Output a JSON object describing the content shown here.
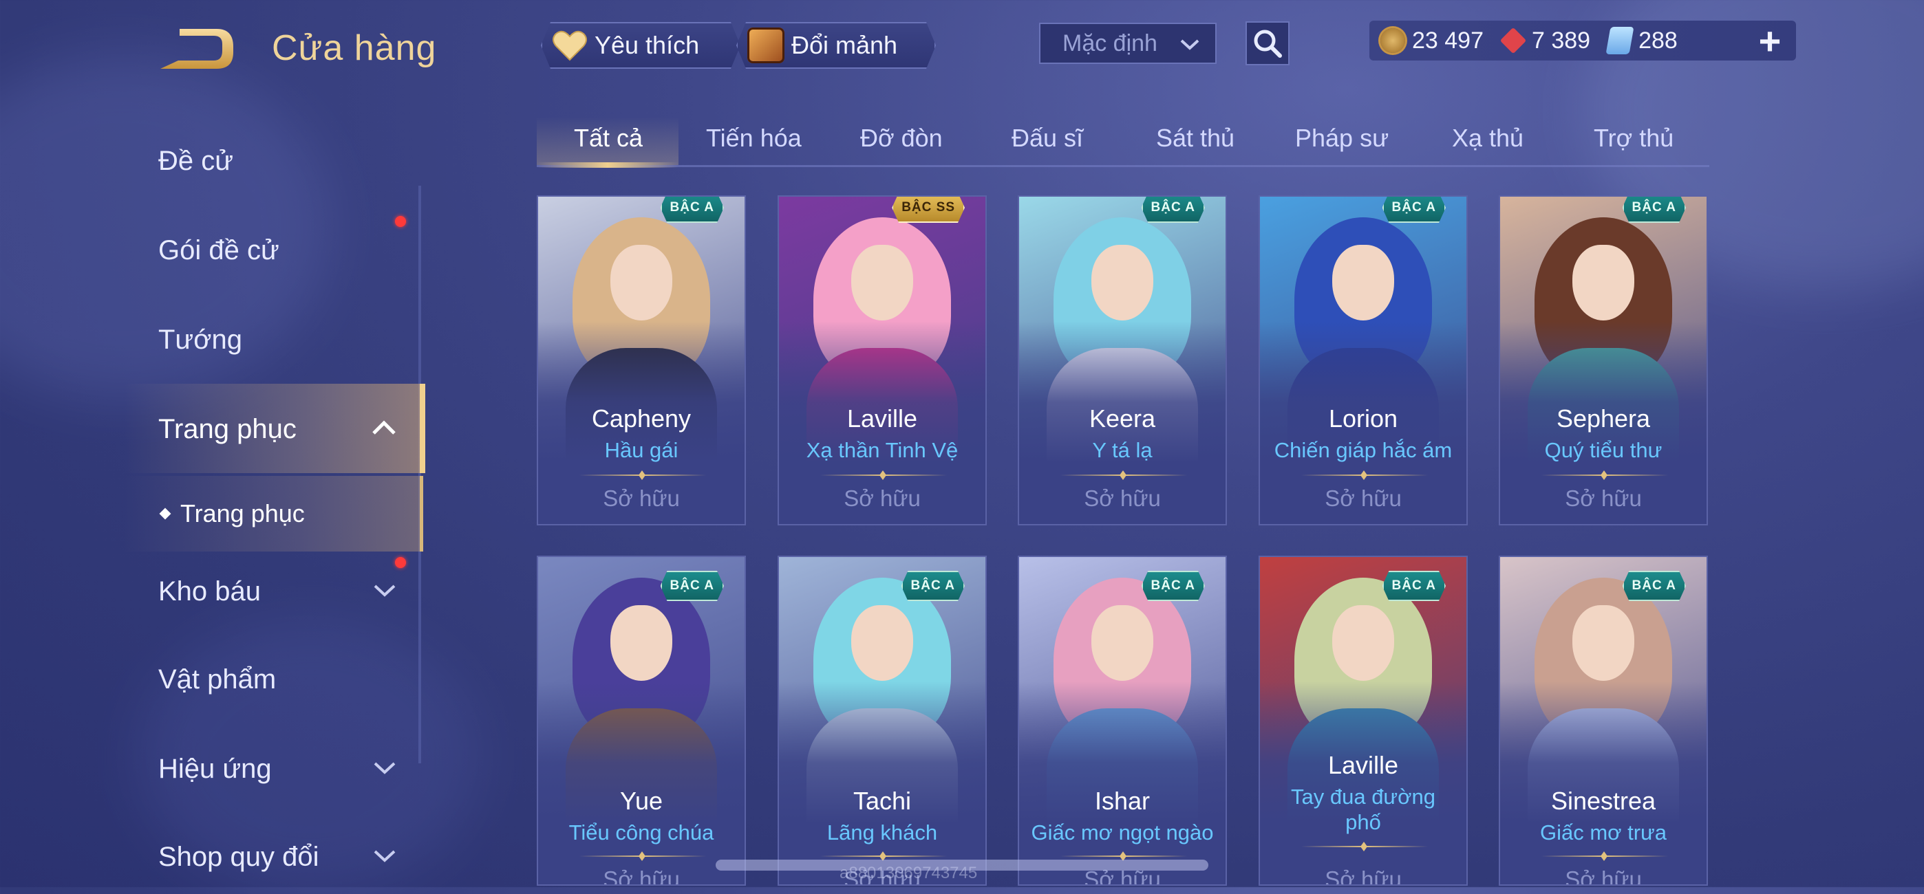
{
  "header": {
    "title": "Cửa hàng",
    "favorite_label": "Yêu thích",
    "exchange_label": "Đổi mảnh",
    "sort_value": "Mặc định",
    "currencies": [
      {
        "icon": "gold-coin-icon",
        "value": "23 497"
      },
      {
        "icon": "ruby-gem-icon",
        "value": "7 389"
      },
      {
        "icon": "voucher-icon",
        "value": "288"
      }
    ],
    "add_label": "+"
  },
  "sidebar": {
    "items": [
      {
        "label": "Đề cử"
      },
      {
        "label": "Gói đề cử"
      },
      {
        "label": "Tướng"
      },
      {
        "label": "Trang phục"
      },
      {
        "label": "Trang phục"
      },
      {
        "label": "Kho báu"
      },
      {
        "label": "Vật phẩm"
      },
      {
        "label": "Hiệu ứng"
      },
      {
        "label": "Shop quy đổi"
      }
    ]
  },
  "tabs": [
    "Tất cả",
    "Tiến hóa",
    "Đỡ đòn",
    "Đấu sĩ",
    "Sát thủ",
    "Pháp sư",
    "Xạ thủ",
    "Trợ thủ"
  ],
  "cards": [
    {
      "hero": "Capheny",
      "skin": "Hầu gái",
      "badge": "BẬC A",
      "status": "Sở hữu",
      "hair": "#d9b48a",
      "outfit": "#2a2a3a",
      "bg": "#c9cfe2"
    },
    {
      "hero": "Laville",
      "skin": "Xạ thần Tinh Vệ",
      "badge": "BẬC SS",
      "status": "Sở hữu",
      "hair": "#f4a0c8",
      "outfit": "#d0308a",
      "bg": "#7c3aa0"
    },
    {
      "hero": "Keera",
      "skin": "Y tá lạ",
      "badge": "BẬC A",
      "status": "Sở hữu",
      "hair": "#7fd0e6",
      "outfit": "#e9e9f4",
      "bg": "#9ad8e8"
    },
    {
      "hero": "Lorion",
      "skin": "Chiến giáp hắc ám",
      "badge": "BẬC A",
      "status": "Sở hữu",
      "hair": "#2e4fb8",
      "outfit": "#2a3f9a",
      "bg": "#4aa0e0"
    },
    {
      "hero": "Sephera",
      "skin": "Quý tiểu thư",
      "badge": "BẬC A",
      "status": "Sở hữu",
      "hair": "#6a3a2a",
      "outfit": "#4aa89a",
      "bg": "#d7b49c"
    },
    {
      "hero": "Yue",
      "skin": "Tiểu công chúa",
      "badge": "BẬC A",
      "status": "Sở hữu",
      "hair": "#4a3f9a",
      "outfit": "#8a6040",
      "bg": "#7a88c0"
    },
    {
      "hero": "Tachi",
      "skin": "Lãng khách",
      "badge": "BẬC A",
      "status": "Sở hữu",
      "hair": "#7fd6e6",
      "outfit": "#c8d8e8",
      "bg": "#9fb4d8"
    },
    {
      "hero": "Ishar",
      "skin": "Giấc mơ ngọt ngào",
      "badge": "BẬC A",
      "status": "Sở hữu",
      "hair": "#e7a0c0",
      "outfit": "#6aa0d8",
      "bg": "#b8c0e8"
    },
    {
      "hero": "Laville",
      "skin": "Tay đua đường phố",
      "badge": "BẬC A",
      "status": "Sở hữu",
      "hair": "#c8d2a0",
      "outfit": "#3a8ab0",
      "bg": "#c04040"
    },
    {
      "hero": "Sinestrea",
      "skin": "Giấc mơ trưa",
      "badge": "BẬC A",
      "status": "Sở hữu",
      "hair": "#c9a090",
      "outfit": "#b8c4e8",
      "bg": "#d8c4c8"
    }
  ],
  "footer": {
    "watermark": "a88013069743745"
  }
}
